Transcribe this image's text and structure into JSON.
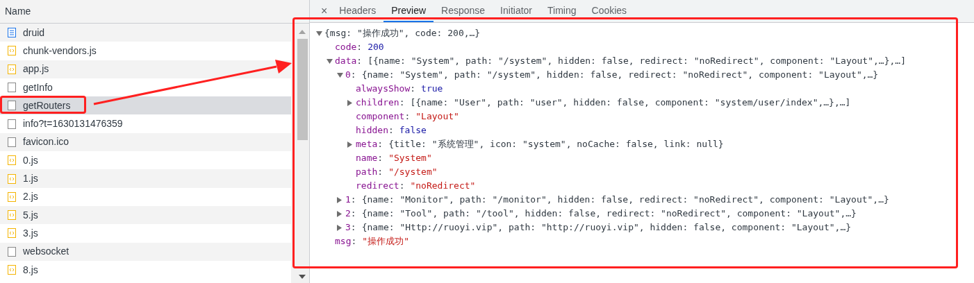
{
  "requests": {
    "header": "Name",
    "rows": [
      {
        "name": "druid",
        "kind": "document",
        "selected": false
      },
      {
        "name": "chunk-vendors.js",
        "kind": "script",
        "selected": false
      },
      {
        "name": "app.js",
        "kind": "script",
        "selected": false
      },
      {
        "name": "getInfo",
        "kind": "other",
        "selected": false
      },
      {
        "name": "getRouters",
        "kind": "other",
        "selected": true
      },
      {
        "name": "info?t=1630131476359",
        "kind": "other",
        "selected": false
      },
      {
        "name": "favicon.ico",
        "kind": "other",
        "selected": false
      },
      {
        "name": "0.js",
        "kind": "script",
        "selected": false
      },
      {
        "name": "1.js",
        "kind": "script",
        "selected": false
      },
      {
        "name": "2.js",
        "kind": "script",
        "selected": false
      },
      {
        "name": "5.js",
        "kind": "script",
        "selected": false
      },
      {
        "name": "3.js",
        "kind": "script",
        "selected": false
      },
      {
        "name": "websocket",
        "kind": "other",
        "selected": false
      },
      {
        "name": "8.js",
        "kind": "script",
        "selected": false
      }
    ]
  },
  "detail": {
    "close": "×",
    "tabs": [
      {
        "label": "Headers",
        "selected": false
      },
      {
        "label": "Preview",
        "selected": true
      },
      {
        "label": "Response",
        "selected": false
      },
      {
        "label": "Initiator",
        "selected": false
      },
      {
        "label": "Timing",
        "selected": false
      },
      {
        "label": "Cookies",
        "selected": false
      }
    ],
    "preview": {
      "value": "{msg: \"操作成功\", code: 200,…}",
      "kind": "object",
      "expanded": true,
      "children": [
        {
          "key": "code:",
          "value": "200",
          "kind": "number"
        },
        {
          "key": "data:",
          "value": "[{name: \"System\", path: \"/system\", hidden: false, redirect: \"noRedirect\", component: \"Layout\",…},…]",
          "kind": "object",
          "expanded": true,
          "children": [
            {
              "key": "0:",
              "value": "{name: \"System\", path: \"/system\", hidden: false, redirect: \"noRedirect\", component: \"Layout\",…}",
              "kind": "object",
              "expanded": true,
              "children": [
                {
                  "key": "alwaysShow:",
                  "value": "true",
                  "kind": "boolean"
                },
                {
                  "key": "children:",
                  "value": "[{name: \"User\", path: \"user\", hidden: false, component: \"system/user/index\",…},…]",
                  "kind": "object",
                  "expanded": false
                },
                {
                  "key": "component:",
                  "value": "\"Layout\"",
                  "kind": "string"
                },
                {
                  "key": "hidden:",
                  "value": "false",
                  "kind": "boolean"
                },
                {
                  "key": "meta:",
                  "value": "{title: \"系统管理\", icon: \"system\", noCache: false, link: null}",
                  "kind": "object",
                  "expanded": false
                },
                {
                  "key": "name:",
                  "value": "\"System\"",
                  "kind": "string"
                },
                {
                  "key": "path:",
                  "value": "\"/system\"",
                  "kind": "string"
                },
                {
                  "key": "redirect:",
                  "value": "\"noRedirect\"",
                  "kind": "string"
                }
              ]
            },
            {
              "key": "1:",
              "value": "{name: \"Monitor\", path: \"/monitor\", hidden: false, redirect: \"noRedirect\", component: \"Layout\",…}",
              "kind": "object",
              "expanded": false
            },
            {
              "key": "2:",
              "value": "{name: \"Tool\", path: \"/tool\", hidden: false, redirect: \"noRedirect\", component: \"Layout\",…}",
              "kind": "object",
              "expanded": false
            },
            {
              "key": "3:",
              "value": "{name: \"Http://ruoyi.vip\", path: \"http://ruoyi.vip\", hidden: false, component: \"Layout\",…}",
              "kind": "object",
              "expanded": false
            }
          ]
        },
        {
          "key": "msg:",
          "value": "\"操作成功\"",
          "kind": "string"
        }
      ]
    }
  }
}
